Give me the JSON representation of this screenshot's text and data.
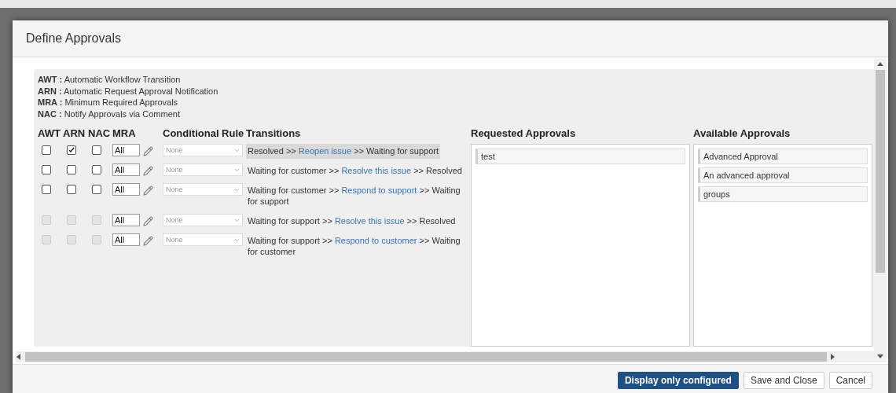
{
  "dialog": {
    "title": "Define Approvals"
  },
  "legend": [
    {
      "abbr": "AWT :",
      "text": "Automatic Workflow Transition"
    },
    {
      "abbr": "ARN :",
      "text": "Automatic Request Approval Notification"
    },
    {
      "abbr": "MRA :",
      "text": "Minimum Required Approvals"
    },
    {
      "abbr": "NAC :",
      "text": "Notify Approvals via Comment"
    }
  ],
  "columns": {
    "awt": "AWT",
    "arn": "ARN",
    "nac": "NAC",
    "mra": "MRA",
    "rule": "Conditional Rule",
    "transitions": "Transitions",
    "requested": "Requested Approvals",
    "available": "Available Approvals"
  },
  "rows": [
    {
      "awt": false,
      "arn": true,
      "nac": false,
      "disabled": false,
      "mra": "All",
      "rule": "None",
      "from": "Resolved >>",
      "action": "Reopen issue",
      "to": ">> Waiting for support",
      "selected": true
    },
    {
      "awt": false,
      "arn": false,
      "nac": false,
      "disabled": false,
      "mra": "All",
      "rule": "None",
      "from": "Waiting for customer >>",
      "action": "Resolve this issue",
      "to": ">> Resolved",
      "selected": false
    },
    {
      "awt": false,
      "arn": false,
      "nac": false,
      "disabled": false,
      "mra": "All",
      "rule": "None",
      "from": "Waiting for customer >>",
      "action": "Respond to support",
      "to": ">> Waiting for support",
      "selected": false
    },
    {
      "awt": false,
      "arn": false,
      "nac": false,
      "disabled": true,
      "mra": "All",
      "rule": "None",
      "from": "Waiting for support >>",
      "action": "Resolve this issue",
      "to": ">> Resolved",
      "selected": false
    },
    {
      "awt": false,
      "arn": false,
      "nac": false,
      "disabled": true,
      "mra": "All",
      "rule": "None",
      "from": "Waiting for support >>",
      "action": "Respond to customer",
      "to": ">> Waiting for customer",
      "selected": false
    }
  ],
  "requested": [
    "test"
  ],
  "available": [
    "Advanced Approval",
    "An advanced approval",
    "groups"
  ],
  "buttons": [
    {
      "label": "Display only configured",
      "kind": "primary"
    },
    {
      "label": "Save and Close",
      "kind": "default"
    },
    {
      "label": "Cancel",
      "kind": "default"
    }
  ]
}
